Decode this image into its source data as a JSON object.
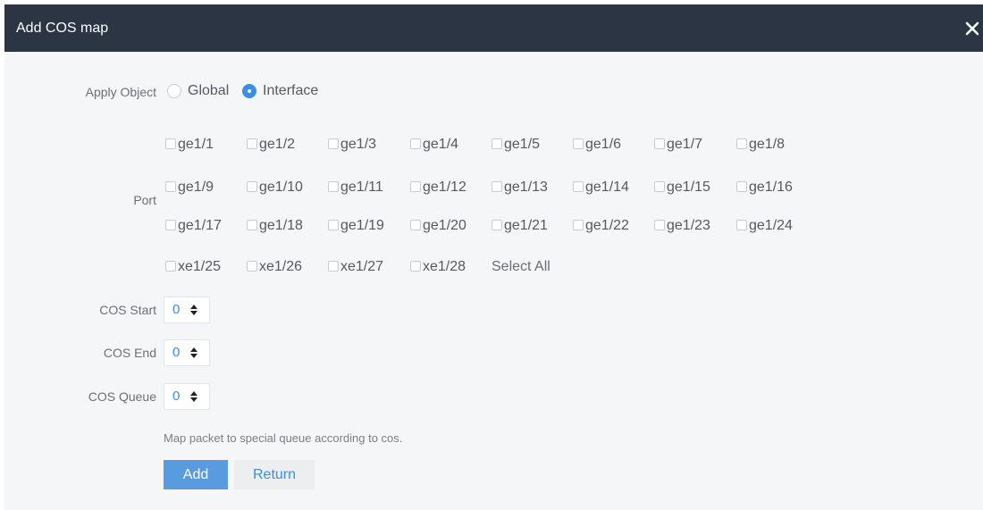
{
  "dialog": {
    "title": "Add COS map",
    "close_icon": "close-icon"
  },
  "apply_object": {
    "label": "Apply Object",
    "options": [
      {
        "label": "Global",
        "checked": false
      },
      {
        "label": "Interface",
        "checked": true
      }
    ]
  },
  "port": {
    "label": "Port",
    "items": [
      "ge1/1",
      "ge1/2",
      "ge1/3",
      "ge1/4",
      "ge1/5",
      "ge1/6",
      "ge1/7",
      "ge1/8",
      "ge1/9",
      "ge1/10",
      "ge1/11",
      "ge1/12",
      "ge1/13",
      "ge1/14",
      "ge1/15",
      "ge1/16",
      "ge1/17",
      "ge1/18",
      "ge1/19",
      "ge1/20",
      "ge1/21",
      "ge1/22",
      "ge1/23",
      "ge1/24",
      "xe1/25",
      "xe1/26",
      "xe1/27",
      "xe1/28"
    ],
    "select_all": "Select All"
  },
  "cos_start": {
    "label": "COS Start",
    "value": "0"
  },
  "cos_end": {
    "label": "COS End",
    "value": "0"
  },
  "cos_queue": {
    "label": "COS Queue",
    "value": "0"
  },
  "hint": "Map packet to special queue according to cos.",
  "buttons": {
    "add": "Add",
    "return": "Return"
  },
  "colors": {
    "title_bar": "#2b3543",
    "accent": "#3a8ee6",
    "body_bg": "#f5f6f7"
  }
}
